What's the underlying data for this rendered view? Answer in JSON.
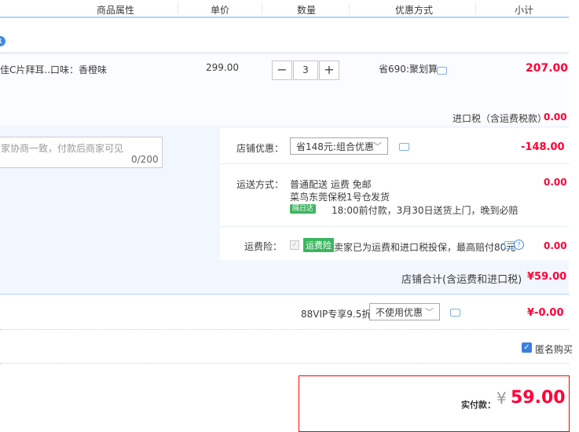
{
  "header": {
    "cols": [
      "商品属性",
      "单价",
      "数量",
      "优惠方式",
      "小计"
    ]
  },
  "shop": {
    "icon_text": "1"
  },
  "item": {
    "title": "佳C片拜耳...",
    "attr": "口味：香橙味",
    "price": "299.00",
    "qty_minus": "−",
    "qty": "3",
    "qty_plus": "+",
    "discount": "省690:聚划算",
    "subtotal": "207.00",
    "tax_label": "进口税（含运费税款）",
    "tax_value": "0.00"
  },
  "message": {
    "placeholder": "家协商一致，付款后商家可见",
    "count": "0/200"
  },
  "shop_discount": {
    "label": "店铺优惠：",
    "select": "省148元:组合优惠",
    "value": "-148.00"
  },
  "shipping": {
    "label": "运送方式：",
    "method": "普通配送 运费 免邮",
    "warehouse": "菜鸟东莞保税1号仓",
    "ship_suffix": "发货",
    "tag": "隔日达",
    "desc": "18:00前付款，3月30日送货上门，晚到必赔",
    "value": "0.00"
  },
  "insurance": {
    "label": "运费险：",
    "tag": "运费险",
    "desc": "卖家已为运费和进口税投保，最高赔付80元",
    "value": "0.00"
  },
  "shop_total": {
    "label": "店铺合计(含运费和进口税)",
    "value": "¥59.00"
  },
  "vip": {
    "label": "88VIP专享9.5折",
    "select": "不使用优惠",
    "value": "¥-0.00"
  },
  "anonymous": {
    "label": "匿名购买"
  },
  "pay": {
    "label": "实付款：",
    "currency": "¥",
    "amount": "59.00"
  }
}
